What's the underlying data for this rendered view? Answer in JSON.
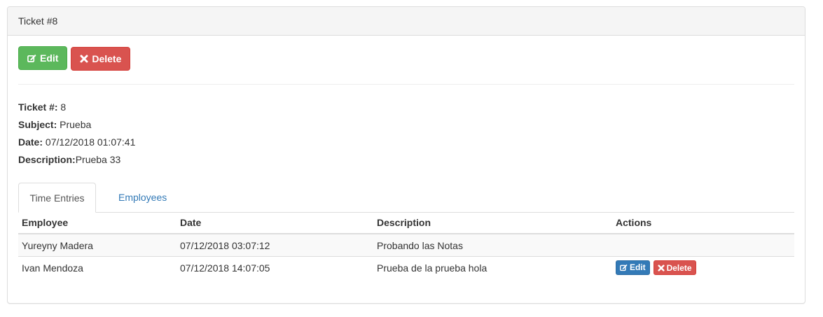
{
  "panel": {
    "title": "Ticket #8"
  },
  "toolbar": {
    "edit_label": "Edit",
    "delete_label": "Delete"
  },
  "details": {
    "ticket_label": "Ticket #:",
    "ticket_value": " 8",
    "subject_label": "Subject:",
    "subject_value": " Prueba",
    "date_label": "Date:",
    "date_value": " 07/12/2018 01:07:41",
    "description_label": "Description:",
    "description_value": "Prueba 33"
  },
  "tabs": [
    {
      "label": "Time Entries",
      "active": true
    },
    {
      "label": "Employees",
      "active": false
    }
  ],
  "table": {
    "headers": [
      "Employee",
      "Date",
      "Description",
      "Actions"
    ],
    "rows": [
      {
        "employee": "Yureyny Madera",
        "date": "07/12/2018 03:07:12",
        "description": "Probando las Notas",
        "actions": false
      },
      {
        "employee": "Ivan Mendoza",
        "date": "07/12/2018 14:07:05",
        "description": "Prueba de la prueba hola",
        "actions": true
      }
    ],
    "row_edit_label": "Edit",
    "row_delete_label": "Delete"
  },
  "colors": {
    "success": "#5cb85c",
    "danger": "#d9534f",
    "primary": "#337ab7",
    "link": "#337ab7"
  },
  "icons": {
    "edit": "edit-icon",
    "delete": "times-icon"
  }
}
